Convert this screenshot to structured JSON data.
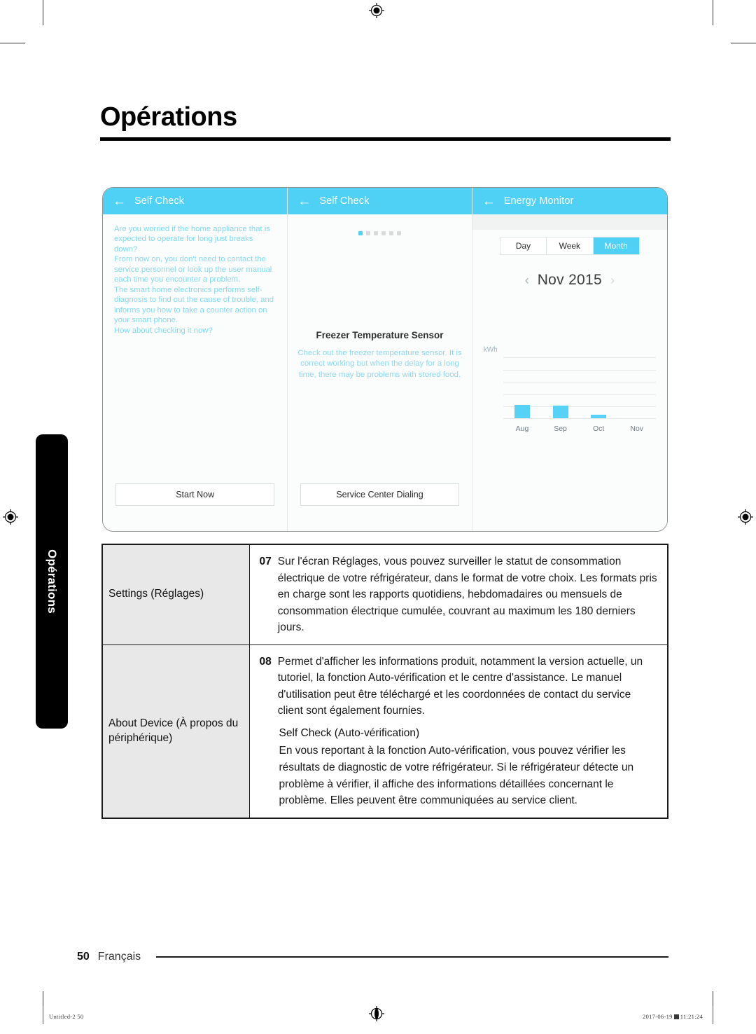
{
  "page": {
    "heading": "Opérations",
    "side_tab_label": "Opérations",
    "footer_page_number": "50",
    "footer_language": "Français"
  },
  "print_marks": {
    "left_text": "Untitled-2   50",
    "right_date": "2017-06-19",
    "right_time": "11:21:24"
  },
  "screens": {
    "self_check_intro": {
      "appbar_title": "Self Check",
      "back_icon": "back-arrow-icon",
      "paragraph": "Are you worried if the home appliance that is expected to operate for long just breaks down?\nFrom now on, you don't need to contact the service personnel or look up the user manual each time you encounter a problem.\nThe smart home electronics performs self-diagnosis to find out the cause of trouble, and informs you how to take a counter action on your smart phone.\nHow about checking it now?",
      "button_label": "Start Now"
    },
    "self_check_result": {
      "appbar_title": "Self Check",
      "back_icon": "back-arrow-icon",
      "carousel_total": 6,
      "carousel_active_index": 0,
      "sensor_title": "Freezer Temperature Sensor",
      "sensor_description": "Check out the freezer temperature sensor. It is correct working but when the delay for a long time, there may be problems with stored food.",
      "button_label": "Service Center Dialing"
    },
    "energy_monitor": {
      "appbar_title": "Energy Monitor",
      "back_icon": "back-arrow-icon",
      "segments": [
        {
          "label": "Day",
          "active": false
        },
        {
          "label": "Week",
          "active": false
        },
        {
          "label": "Month",
          "active": true
        }
      ],
      "prev_icon": "chevron-left-icon",
      "next_icon": "chevron-right-icon",
      "period_label": "Nov 2015"
    }
  },
  "chart_data": {
    "type": "bar",
    "title": "",
    "xlabel": "",
    "ylabel": "kWh",
    "categories": [
      "Aug",
      "Sep",
      "Oct",
      "Nov"
    ],
    "values": [
      22,
      21,
      6,
      0
    ],
    "ylim": [
      0,
      100
    ],
    "gridlines": 5,
    "grid": true,
    "legend": "none",
    "bar_color": "#56d2f6"
  },
  "table": {
    "rows": [
      {
        "label": "Settings (Réglages)",
        "number": "07",
        "text": "Sur l'écran Réglages, vous pouvez surveiller le statut de consommation électrique de votre réfrigérateur, dans le format de votre choix. Les formats pris en charge sont les rapports quotidiens, hebdomadaires ou mensuels de consommation électrique cumulée, couvrant au maximum les 180 derniers jours."
      },
      {
        "label": "About Device (À propos du périphérique)",
        "number": "08",
        "text": "Permet d'afficher les informations produit, notamment la version actuelle, un tutoriel, la fonction Auto-vérification et le centre d'assistance. Le manuel d'utilisation peut être téléchargé et les coordonnées de contact du service client sont également fournies.",
        "sub_heading": "Self Check (Auto-vérification)",
        "sub_text": "En vous reportant à la fonction Auto-vérification, vous pouvez vérifier les résultats de diagnostic de votre réfrigérateur. Si le réfrigérateur détecte un problème à vérifier, il affiche des informations détaillées concernant le problème. Elles peuvent être communiquées au service client."
      }
    ]
  },
  "colors": {
    "accent_cyan": "#4fd0f5",
    "bar_cyan": "#56d2f6",
    "body_text_cyan": "#84d9ef",
    "table_label_bg": "#e8e8e8",
    "ink": "#1a1a1a"
  }
}
